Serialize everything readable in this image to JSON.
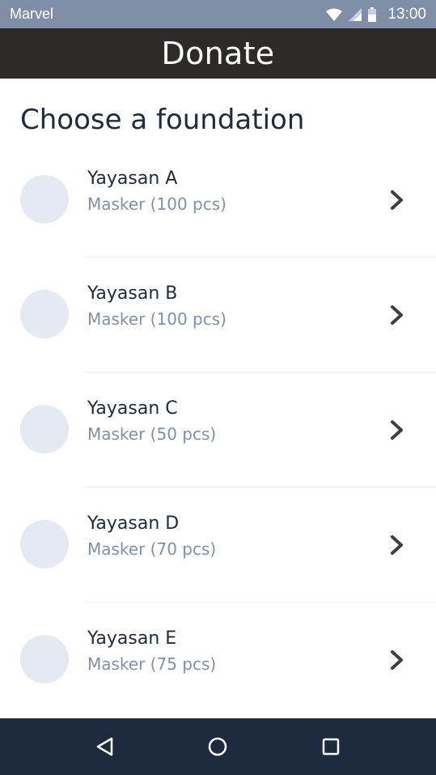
{
  "status_bar": {
    "carrier": "Marvel",
    "time": "13:00",
    "icons": [
      "wifi-icon",
      "signal-icon",
      "battery-icon"
    ]
  },
  "app_bar": {
    "title": "Donate"
  },
  "section": {
    "heading": "Choose a foundation"
  },
  "foundations": [
    {
      "name": "Yayasan A",
      "description": "Masker (100 pcs)"
    },
    {
      "name": "Yayasan B",
      "description": "Masker (100 pcs)"
    },
    {
      "name": "Yayasan C",
      "description": "Masker (50 pcs)"
    },
    {
      "name": "Yayasan D",
      "description": "Masker (70 pcs)"
    },
    {
      "name": "Yayasan E",
      "description": "Masker (75 pcs)"
    }
  ],
  "nav_bar": {
    "icons": [
      "back-icon",
      "home-icon",
      "recents-icon"
    ]
  },
  "colors": {
    "status_bar": "#7f8da6",
    "app_bar": "#2d2b2a",
    "nav_bar": "#1e2a3e",
    "avatar": "#e4e9f2",
    "title_text": "#1f2a3a",
    "subtitle_text": "#8190a6"
  }
}
